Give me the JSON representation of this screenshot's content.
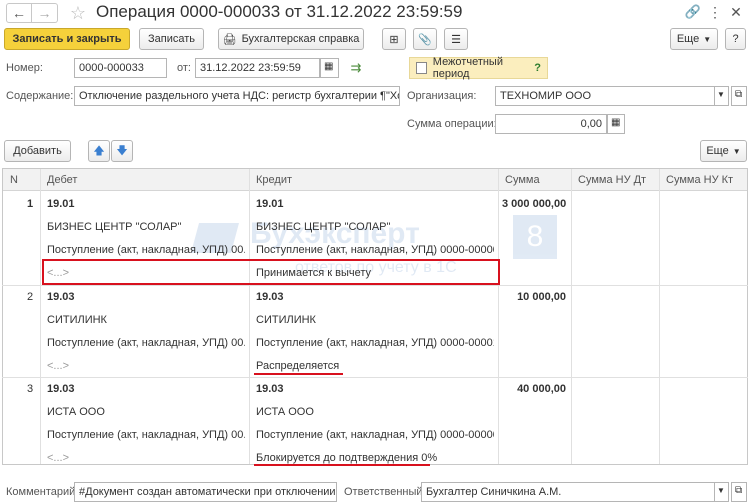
{
  "title": "Операция 0000-000033 от 31.12.2022 23:59:59",
  "toolbar": {
    "post_close": "Записать и закрыть",
    "save": "Записать",
    "report": "Бухгалтерская справка",
    "more": "Еще"
  },
  "form": {
    "number_label": "Номер:",
    "number": "0000-000033",
    "from_label": "от:",
    "date": "31.12.2022 23:59:59",
    "interim_label": "Межотчетный период",
    "interim_help": "?",
    "content_label": "Содержание:",
    "content": "Отключение раздельного учета НДС: регистр бухгалтерии ¶\"Хозрасчетный\"",
    "org_label": "Организация:",
    "org": "ТЕХНОМИР ООО",
    "amount_label": "Сумма операции:",
    "amount": "0,00"
  },
  "table_toolbar": {
    "add": "Добавить",
    "more": "Еще"
  },
  "table": {
    "headers": [
      "N",
      "Дебет",
      "Кредит",
      "Сумма",
      "Сумма НУ Дт",
      "Сумма НУ Кт"
    ],
    "rows": [
      {
        "n": "1",
        "debit_account": "19.01",
        "debit_sub1": "БИЗНЕС ЦЕНТР \"СОЛАР\"",
        "debit_sub2": "Поступление (акт, накладная, УПД) 00...",
        "debit_sub3": "<...>",
        "credit_account": "19.01",
        "credit_sub1": "БИЗНЕС ЦЕНТР \"СОЛАР\"",
        "credit_sub2": "Поступление (акт, накладная, УПД) 0000-00000...",
        "credit_sub3": "Принимается к вычету",
        "sum": "3 000 000,00"
      },
      {
        "n": "2",
        "debit_account": "19.03",
        "debit_sub1": "СИТИЛИНК",
        "debit_sub2": "Поступление (акт, накладная, УПД) 00...",
        "debit_sub3": "<...>",
        "credit_account": "19.03",
        "credit_sub1": "СИТИЛИНК",
        "credit_sub2": "Поступление (акт, накладная, УПД) 0000-00001...",
        "credit_sub3": "Распределяется",
        "sum": "10 000,00"
      },
      {
        "n": "3",
        "debit_account": "19.03",
        "debit_sub1": "ИСТА ООО",
        "debit_sub2": "Поступление (акт, накладная, УПД) 00...",
        "debit_sub3": "<...>",
        "credit_account": "19.03",
        "credit_sub1": "ИСТА ООО",
        "credit_sub2": "Поступление (акт, накладная, УПД) 0000-00000...",
        "credit_sub3": "Блокируется до подтверждения 0%",
        "sum": "40 000,00"
      }
    ]
  },
  "watermark": {
    "text": "Бухэксперт",
    "digit": "8",
    "tagline": "ответов по учету в 1С"
  },
  "footer": {
    "comment_label": "Комментарий:",
    "comment": "#Документ создан автоматически при отключении раздельного учета",
    "resp_label": "Ответственный:",
    "resp": "Бухгалтер Синичкина А.М."
  },
  "colors": {
    "accent": "#f5d13b",
    "highlight": "#d8111e"
  }
}
